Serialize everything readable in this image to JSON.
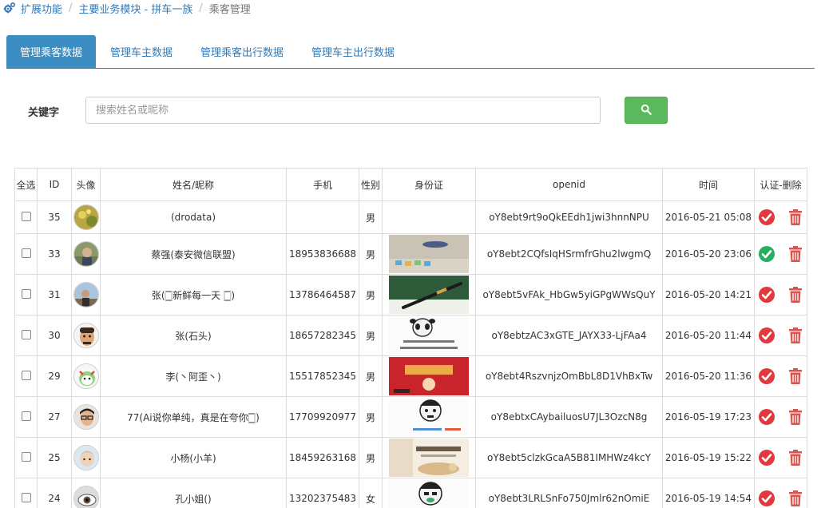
{
  "breadcrumb": {
    "items": [
      "扩展功能",
      "主要业务模块 - 拼车一族"
    ],
    "current": "乘客管理"
  },
  "tabs": [
    {
      "label": "管理乘客数据",
      "active": true
    },
    {
      "label": "管理车主数据",
      "active": false
    },
    {
      "label": "管理乘客出行数据",
      "active": false
    },
    {
      "label": "管理车主出行数据",
      "active": false
    }
  ],
  "search": {
    "label": "关键字",
    "placeholder": "搜索姓名或昵称",
    "icon": "search-icon"
  },
  "table": {
    "headers": [
      "全选",
      "ID",
      "头像",
      "姓名/昵称",
      "手机",
      "性别",
      "身份证",
      "openid",
      "时间",
      "认证-删除"
    ],
    "rows": [
      {
        "id": "35",
        "name": "(drodata)",
        "phone": "",
        "gender": "男",
        "openid": "oY8ebt9rt9oQkEEdh1jwi3hnnNPU",
        "time": "2016-05-21 05:08",
        "verified": false
      },
      {
        "id": "33",
        "name": "蔡强(泰安微信联盟)",
        "phone": "18953836688",
        "gender": "男",
        "openid": "oY8ebt2CQfsIqHSrmfrGhu2lwgmQ",
        "time": "2016-05-20 23:06",
        "verified": true
      },
      {
        "id": "31",
        "name": "张(🀆新鲜每一天 🀆)",
        "phone": "13786464587",
        "gender": "男",
        "openid": "oY8ebt5vFAk_HbGw5yiGPgWWsQuY",
        "time": "2016-05-20 14:21",
        "verified": false
      },
      {
        "id": "30",
        "name": "张(石头)",
        "phone": "18657282345",
        "gender": "男",
        "openid": "oY8ebtzAC3xGTE_JAYX33-LjFAa4",
        "time": "2016-05-20 11:44",
        "verified": false
      },
      {
        "id": "29",
        "name": "李(丶阿歪丶)",
        "phone": "15517852345",
        "gender": "男",
        "openid": "oY8ebt4RszvnjzOmBbL8D1VhBxTw",
        "time": "2016-05-20 11:36",
        "verified": false
      },
      {
        "id": "27",
        "name": "77(Ai说你单纯，真是在夸你🀆)",
        "phone": "17709920977",
        "gender": "男",
        "openid": "oY8ebtxCAybailuosU7JL3OzcN8g",
        "time": "2016-05-19 17:23",
        "verified": false
      },
      {
        "id": "25",
        "name": "小杨(小羊)",
        "phone": "18459263168",
        "gender": "男",
        "openid": "oY8ebt5clzkGcaA5B81IMHWz4kcY",
        "time": "2016-05-19 15:22",
        "verified": false
      },
      {
        "id": "24",
        "name": "孔小姐()",
        "phone": "13202375483",
        "gender": "女",
        "openid": "oY8ebt3LRLSnFo750Jmlr62nOmiE",
        "time": "2016-05-19 14:54",
        "verified": false
      }
    ]
  },
  "colors": {
    "link": "#337ab7",
    "tab_active": "#3c8dc2",
    "search_button": "#5cb85c",
    "verify_red": "#e0393e",
    "verify_green": "#27ae60",
    "delete_red": "#d9534f"
  }
}
